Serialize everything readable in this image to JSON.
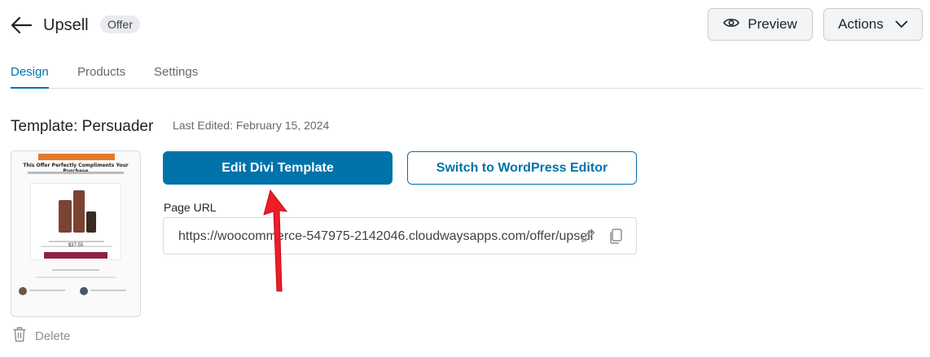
{
  "header": {
    "title": "Upsell",
    "badge": "Offer",
    "preview_label": "Preview",
    "actions_label": "Actions"
  },
  "tabs": [
    {
      "label": "Design",
      "active": true
    },
    {
      "label": "Products",
      "active": false
    },
    {
      "label": "Settings",
      "active": false
    }
  ],
  "template": {
    "title": "Template: Persuader",
    "last_edited": "Last Edited: February 15, 2024",
    "thumbnail_heading": "This Offer Perfectly Compliments Your Purchase",
    "thumbnail_price": "$37.55"
  },
  "buttons": {
    "edit_divi": "Edit Divi Template",
    "switch_editor": "Switch to WordPress Editor"
  },
  "page_url": {
    "label": "Page URL",
    "value": "https://woocommerce-547975-2142046.cloudwaysapps.com/offer/upsell"
  },
  "delete_label": "Delete",
  "colors": {
    "accent": "#0073aa",
    "arrow": "#ee1c25"
  },
  "icons": {
    "back": "arrow-left-icon",
    "preview": "eye-icon",
    "actions": "chevron-down-icon",
    "edit": "pencil-icon",
    "copy": "copy-icon",
    "delete": "trash-icon"
  }
}
